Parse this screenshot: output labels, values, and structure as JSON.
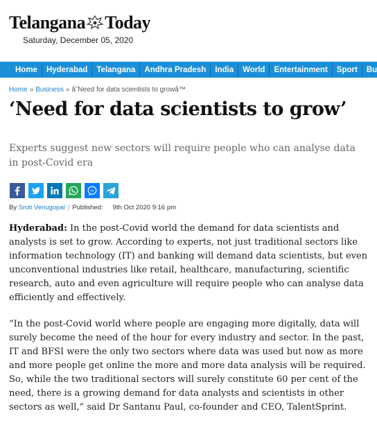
{
  "site": {
    "logo_left": "Telangana",
    "logo_right": "Today",
    "date": "Saturday, December 05, 2020"
  },
  "nav": {
    "items": [
      "Home",
      "Hyderabad",
      "Telangana",
      "Andhra Pradesh",
      "India",
      "World",
      "Entertainment",
      "Sport",
      "Business"
    ]
  },
  "breadcrumb": {
    "home": "Home",
    "section": "Business",
    "current": "â˜Need for data scientists to growâ™"
  },
  "article": {
    "title": "‘Need for data scientists to grow’",
    "subtitle": "Experts suggest new sectors will require people who can analyse data in post-Covid era",
    "byline_prefix": "By",
    "author": "Sruti Venugopal",
    "published_label": "Published:",
    "published_date": "9th Oct 2020",
    "published_time": "9:16 pm",
    "p1_lead": "Hyderabad:",
    "p1_text": " In the post-Covid world the demand for data scientists and analysts is set to grow. According to experts, not just traditional sectors like information technology (IT) and banking will demand data scientists, but even unconventional industries like retail, healthcare, manufacturing, scientific research, auto and even agriculture will require people who can analyse data efficiently and effectively.",
    "p2_text": "“In the post-Covid world where people are engaging more digitally, data will surely become the need of the hour for every industry and sector. In the past, IT and BFSI were the only two sectors where data was used but now as more and more people get online the more and more data analysis will be required. So, while the two traditional sectors will surely constitute 60 per cent of the need, there is a growing demand for data analysts and scientists in other sectors as well,” said Dr Santanu Paul, co-founder and CEO, TalentSprint."
  },
  "share_icons": [
    "facebook-icon",
    "twitter-icon",
    "linkedin-icon",
    "whatsapp-icon",
    "messenger-icon",
    "telegram-icon"
  ],
  "colors": {
    "nav_bg": "#1a8fd8",
    "link": "#1a7fc4",
    "facebook": "#3b5998",
    "twitter": "#1da1f2",
    "linkedin": "#0077b5",
    "whatsapp": "#25a55a",
    "messenger": "#0a7cff",
    "telegram": "#2aa3db"
  }
}
